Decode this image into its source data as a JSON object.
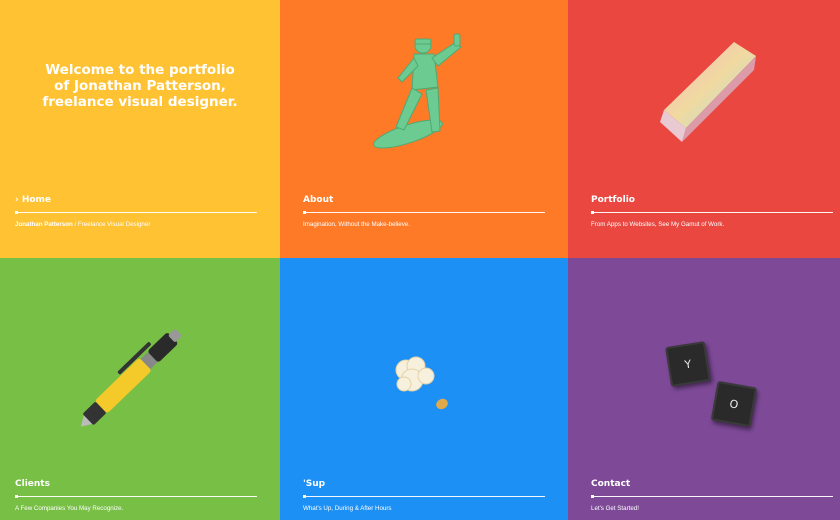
{
  "welcome": "Welcome to the portfolio of Jonathan Patterson, freelance visual designer.",
  "tiles": [
    {
      "label": "› Home",
      "tagline_strong": "Jonathan Patterson",
      "tagline": " / Freelance Visual Designer",
      "color": "#FFC233"
    },
    {
      "label": "About",
      "tagline": "Imagination, Without the Make-believe.",
      "color": "#FF7A27",
      "illustration": "toy-soldier-icon"
    },
    {
      "label": "Portfolio",
      "tagline": "From Apps to Websites, See My Gamut of Work.",
      "color": "#E94740",
      "illustration": "prism-icon"
    },
    {
      "label": "Clients",
      "tagline": "A Few Companies You May Recognize.",
      "color": "#77BF45",
      "illustration": "pen-icon"
    },
    {
      "label": "'Sup",
      "tagline": "What's Up, During & After Hours",
      "color": "#1C90F5",
      "illustration": "popcorn-icon"
    },
    {
      "label": "Contact",
      "tagline": "Let's Get Started!",
      "color": "#7E4A98",
      "illustration": "keycaps-icon"
    }
  ],
  "keys": [
    "Y",
    "O"
  ]
}
